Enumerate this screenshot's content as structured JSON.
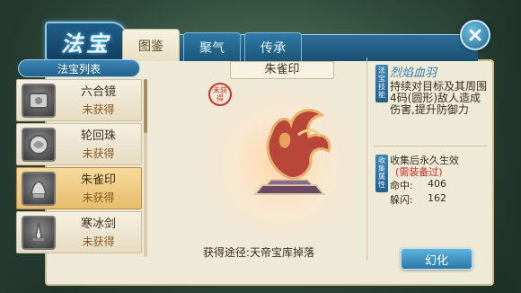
{
  "window": {
    "title_emblem": "法宝",
    "tabs": [
      {
        "label": "图鉴",
        "active": true
      },
      {
        "label": "聚气",
        "active": false
      },
      {
        "label": "传承",
        "active": false
      }
    ]
  },
  "list": {
    "header": "法宝列表",
    "items": [
      {
        "name": "六合镜",
        "status": "未获得",
        "icon": "mirror-icon",
        "selected": false
      },
      {
        "name": "轮回珠",
        "status": "未获得",
        "icon": "orb-icon",
        "selected": false
      },
      {
        "name": "朱雀印",
        "status": "未获得",
        "icon": "phoenix-seal-icon",
        "selected": true
      },
      {
        "name": "寒冰剑",
        "status": "未获得",
        "icon": "sword-icon",
        "selected": false
      }
    ]
  },
  "detail": {
    "name": "朱雀印",
    "seal_text": "未获得",
    "acquire_text": "获得途径:天帝宝库掉落"
  },
  "skill": {
    "vertical_label": "法宝技能",
    "name": "烈焰血羽",
    "description": "持续对目标及其周围4码(圆形)敌人造成伤害,提升防御力"
  },
  "collection": {
    "vertical_label": "收集属性",
    "title": "收集后永久生效",
    "requirement": "(需装备过)",
    "stats": [
      {
        "label": "命中:",
        "value": "406"
      },
      {
        "label": "躲闪:",
        "value": "162"
      }
    ]
  },
  "action": {
    "label": "幻化"
  },
  "colors": {
    "accent_blue": "#2f7aa8",
    "panel": "#efe9d8",
    "selected": "#f6d99b",
    "warning": "#cf2b22"
  }
}
